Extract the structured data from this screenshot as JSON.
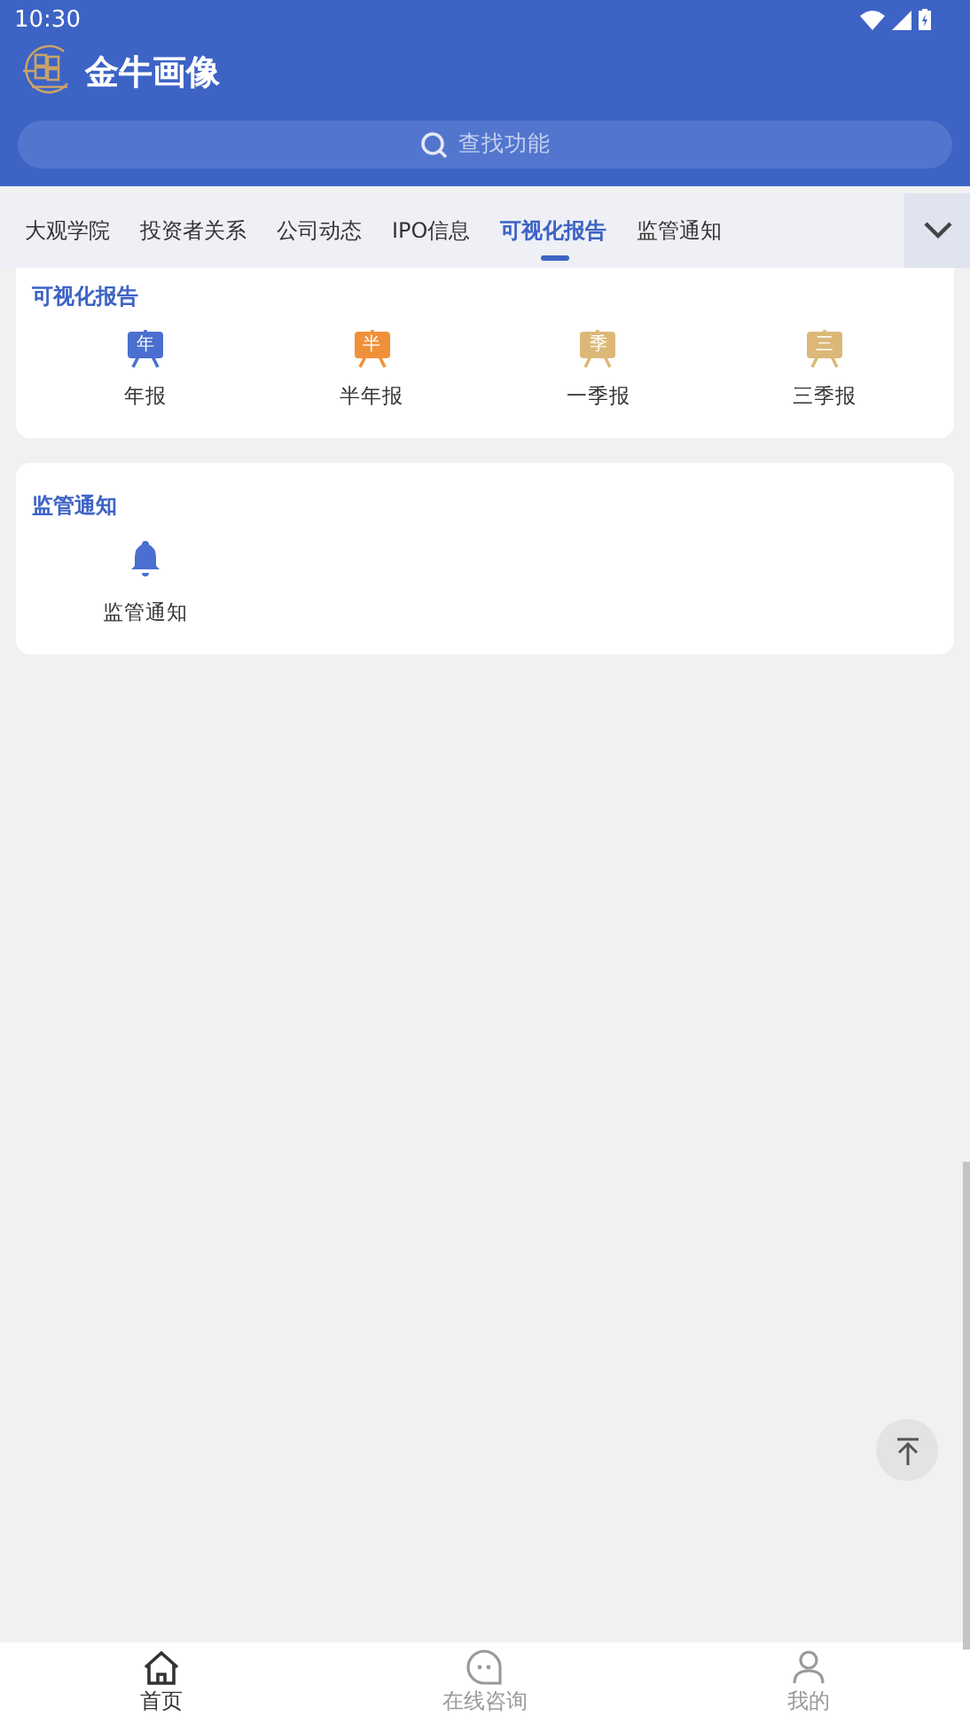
{
  "status_bar": {
    "time": "10:30"
  },
  "app_bar": {
    "title": "金牛画像",
    "search": {
      "placeholder": "查找功能"
    }
  },
  "tabs": [
    {
      "label": "大观学院",
      "selected": false
    },
    {
      "label": "投资者关系",
      "selected": false
    },
    {
      "label": "公司动态",
      "selected": false
    },
    {
      "label": "IPO信息",
      "selected": false
    },
    {
      "label": "可视化报告",
      "selected": true
    },
    {
      "label": "监管通知",
      "selected": false
    }
  ],
  "sections": [
    {
      "title": "可视化报告",
      "items": [
        {
          "kind": "badge",
          "badge": "年",
          "label": "年报",
          "color": "#4a6fd0"
        },
        {
          "kind": "badge",
          "badge": "半",
          "label": "半年报",
          "color": "#f0913a"
        },
        {
          "kind": "badge",
          "badge": "季",
          "label": "一季报",
          "color": "#dcb878"
        },
        {
          "kind": "badge",
          "badge": "三",
          "label": "三季报",
          "color": "#dcb878"
        }
      ]
    },
    {
      "title": "监管通知",
      "items": [
        {
          "kind": "bell",
          "label": "监管通知",
          "color": "#4a6fd0"
        }
      ]
    }
  ],
  "bottom_nav": [
    {
      "kind": "home",
      "label": "首页",
      "selected": true
    },
    {
      "kind": "chat",
      "label": "在线咨询",
      "selected": false
    },
    {
      "kind": "person",
      "label": "我的",
      "selected": false
    }
  ]
}
